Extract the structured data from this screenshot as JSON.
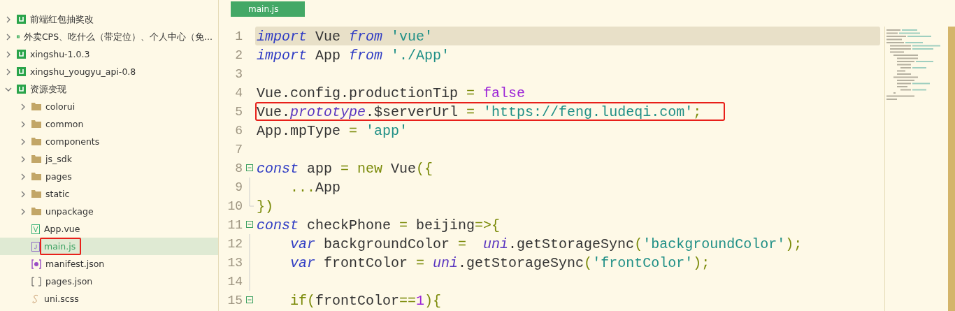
{
  "sidebar": {
    "items": [
      {
        "kind": "project",
        "label": "前端红包抽奖改",
        "expanded": false
      },
      {
        "kind": "project",
        "label": "外卖CPS、吃什么（带定位）、个人中心（免...",
        "expanded": false
      },
      {
        "kind": "project",
        "label": "xingshu-1.0.3",
        "expanded": false
      },
      {
        "kind": "project",
        "label": "xingshu_yougyu_api-0.8",
        "expanded": false
      },
      {
        "kind": "project",
        "label": "资源变现",
        "expanded": true,
        "children": [
          {
            "kind": "folder",
            "label": "colorui",
            "expanded": false
          },
          {
            "kind": "folder",
            "label": "common",
            "expanded": false
          },
          {
            "kind": "folder",
            "label": "components",
            "expanded": false
          },
          {
            "kind": "folder",
            "label": "js_sdk",
            "expanded": false
          },
          {
            "kind": "folder",
            "label": "pages",
            "expanded": false
          },
          {
            "kind": "folder",
            "label": "static",
            "expanded": false
          },
          {
            "kind": "folder",
            "label": "unpackage",
            "expanded": false
          },
          {
            "kind": "vue",
            "label": "App.vue",
            "selected": false,
            "marked": false
          },
          {
            "kind": "js",
            "label": "main.js",
            "selected": true,
            "marked": true
          },
          {
            "kind": "manifest",
            "label": "manifest.json",
            "selected": false,
            "marked": false
          },
          {
            "kind": "json",
            "label": "pages.json",
            "selected": false,
            "marked": false
          },
          {
            "kind": "scss",
            "label": "uni.scss",
            "selected": false,
            "marked": false
          }
        ]
      }
    ]
  },
  "editor": {
    "tabs": [
      {
        "label": "main.js",
        "selected": true
      }
    ],
    "lines": [
      {
        "number": "1",
        "kind": "plain",
        "current": true,
        "marked": false,
        "tokens": [
          {
            "kind": "keyword",
            "text": "import"
          },
          {
            "kind": "plain",
            "text": " Vue "
          },
          {
            "kind": "keyword",
            "text": "from"
          },
          {
            "kind": "string",
            "text": " 'vue'"
          }
        ]
      },
      {
        "number": "2",
        "kind": "plain",
        "current": false,
        "marked": false,
        "tokens": [
          {
            "kind": "keyword",
            "text": "import"
          },
          {
            "kind": "plain",
            "text": " App "
          },
          {
            "kind": "keyword",
            "text": "from"
          },
          {
            "kind": "string",
            "text": " './App'"
          }
        ]
      },
      {
        "number": "3",
        "kind": "plain",
        "current": false,
        "marked": false
      },
      {
        "number": "4",
        "kind": "plain",
        "current": false,
        "marked": false,
        "tokens": [
          {
            "kind": "plain",
            "text": "Vue.config.productionTip "
          },
          {
            "kind": "operator",
            "text": "="
          },
          {
            "kind": "literal",
            "text": " false"
          }
        ]
      },
      {
        "number": "5",
        "kind": "plain",
        "current": false,
        "marked": true,
        "tokens": [
          {
            "kind": "plain",
            "text": "Vue."
          },
          {
            "kind": "object",
            "text": "prototype"
          },
          {
            "kind": "plain",
            "text": ".$serverUrl "
          },
          {
            "kind": "operator",
            "text": "="
          },
          {
            "kind": "string",
            "text": " 'https://feng.ludeqi.com'"
          },
          {
            "kind": "operator",
            "text": ";"
          }
        ]
      },
      {
        "number": "6",
        "kind": "plain",
        "current": false,
        "marked": false,
        "tokens": [
          {
            "kind": "plain",
            "text": "App.mpType "
          },
          {
            "kind": "operator",
            "text": "="
          },
          {
            "kind": "string",
            "text": " 'app'"
          }
        ]
      },
      {
        "number": "7",
        "kind": "plain",
        "current": false,
        "marked": false
      },
      {
        "number": "8",
        "kind": "fold-start",
        "current": false,
        "marked": false,
        "tokens": [
          {
            "kind": "keyword",
            "text": "const"
          },
          {
            "kind": "plain",
            "text": " app "
          },
          {
            "kind": "operator",
            "text": "= new"
          },
          {
            "kind": "plain",
            "text": " Vue"
          },
          {
            "kind": "operator",
            "text": "({"
          }
        ]
      },
      {
        "number": "9",
        "kind": "fold-body",
        "current": false,
        "marked": false,
        "tokens": [
          {
            "kind": "operator",
            "text": "    ..."
          },
          {
            "kind": "plain",
            "text": "App"
          }
        ]
      },
      {
        "number": "10",
        "kind": "fold-end",
        "current": false,
        "marked": false,
        "tokens": [
          {
            "kind": "operator",
            "text": "})"
          }
        ]
      },
      {
        "number": "11",
        "kind": "fold-start",
        "current": false,
        "marked": false,
        "tokens": [
          {
            "kind": "keyword",
            "text": "const"
          },
          {
            "kind": "plain",
            "text": " checkPhone "
          },
          {
            "kind": "operator",
            "text": "="
          },
          {
            "kind": "plain",
            "text": " beijing"
          },
          {
            "kind": "operator",
            "text": "=>{"
          }
        ]
      },
      {
        "number": "12",
        "kind": "fold-body",
        "current": false,
        "marked": false,
        "tokens": [
          {
            "kind": "keyword",
            "text": "    var"
          },
          {
            "kind": "plain",
            "text": " backgroundColor "
          },
          {
            "kind": "operator",
            "text": "="
          },
          {
            "kind": "object",
            "text": "  uni"
          },
          {
            "kind": "plain",
            "text": ".getStorageSync"
          },
          {
            "kind": "operator",
            "text": "("
          },
          {
            "kind": "string",
            "text": "'backgroundColor'"
          },
          {
            "kind": "operator",
            "text": ");"
          }
        ]
      },
      {
        "number": "13",
        "kind": "fold-body",
        "current": false,
        "marked": false,
        "tokens": [
          {
            "kind": "keyword",
            "text": "    var"
          },
          {
            "kind": "plain",
            "text": " frontColor "
          },
          {
            "kind": "operator",
            "text": "="
          },
          {
            "kind": "object",
            "text": " uni"
          },
          {
            "kind": "plain",
            "text": ".getStorageSync"
          },
          {
            "kind": "operator",
            "text": "("
          },
          {
            "kind": "string",
            "text": "'frontColor'"
          },
          {
            "kind": "operator",
            "text": ");"
          }
        ]
      },
      {
        "number": "14",
        "kind": "fold-body",
        "current": false,
        "marked": false
      },
      {
        "number": "15",
        "kind": "fold-start",
        "current": false,
        "marked": false,
        "tokens": [
          {
            "kind": "operator",
            "text": "    if("
          },
          {
            "kind": "plain",
            "text": "frontColor"
          },
          {
            "kind": "operator",
            "text": "=="
          },
          {
            "kind": "literal",
            "text": "1"
          },
          {
            "kind": "operator",
            "text": "){"
          }
        ]
      }
    ]
  }
}
